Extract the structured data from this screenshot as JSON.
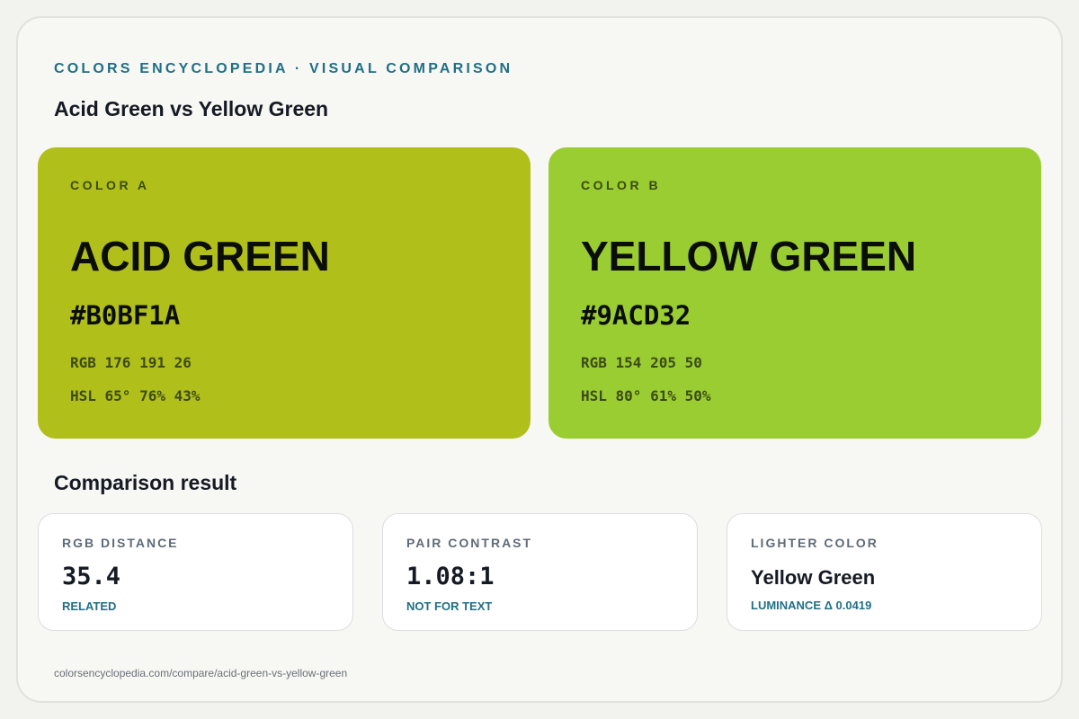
{
  "header": {
    "eyebrow": "COLORS ENCYCLOPEDIA · VISUAL COMPARISON",
    "title": "Acid Green vs Yellow Green"
  },
  "colors": {
    "a": {
      "label": "COLOR A",
      "name": "ACID GREEN",
      "hex": "#B0BF1A",
      "rgb": "RGB 176 191 26",
      "hsl": "HSL 65° 76% 43%",
      "swatch_color": "#b0bf1a"
    },
    "b": {
      "label": "COLOR B",
      "name": "YELLOW GREEN",
      "hex": "#9ACD32",
      "rgb": "RGB 154 205 50",
      "hsl": "HSL 80° 61% 50%",
      "swatch_color": "#9acd32"
    }
  },
  "comparison": {
    "title": "Comparison result",
    "cards": [
      {
        "label": "RGB DISTANCE",
        "value": "35.4",
        "sub": "RELATED"
      },
      {
        "label": "PAIR CONTRAST",
        "value": "1.08:1",
        "sub": "NOT FOR TEXT"
      },
      {
        "label": "LIGHTER COLOR",
        "value": "Yellow Green",
        "sub": "LUMINANCE Δ 0.0419"
      }
    ]
  },
  "footer": {
    "url": "colorsencyclopedia.com/compare/acid-green-vs-yellow-green"
  },
  "theme": {
    "accent": "#1f6f86",
    "text_dark": "#151a24"
  }
}
